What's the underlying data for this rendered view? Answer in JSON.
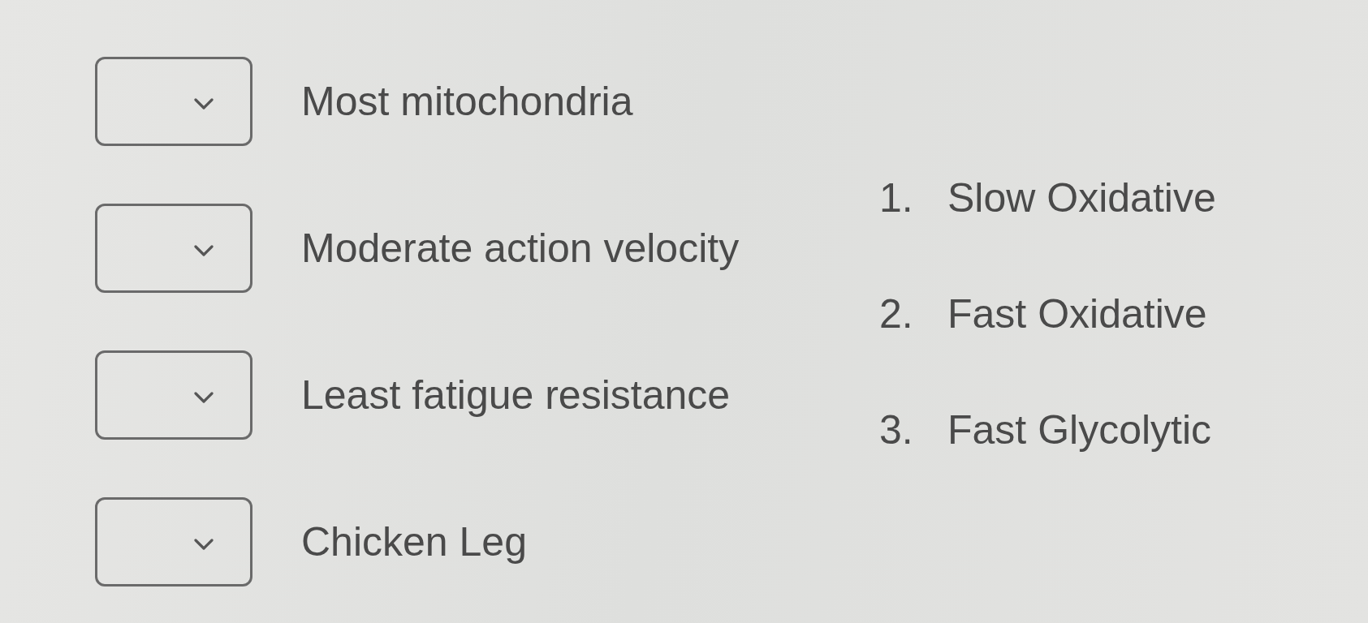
{
  "prompts": [
    {
      "text": "Most mitochondria"
    },
    {
      "text": "Moderate action velocity"
    },
    {
      "text": "Least fatigue resistance"
    },
    {
      "text": "Chicken Leg"
    }
  ],
  "options": [
    {
      "number": "1.",
      "text": "Slow Oxidative"
    },
    {
      "number": "2.",
      "text": "Fast Oxidative"
    },
    {
      "number": "3.",
      "text": "Fast Glycolytic"
    }
  ]
}
